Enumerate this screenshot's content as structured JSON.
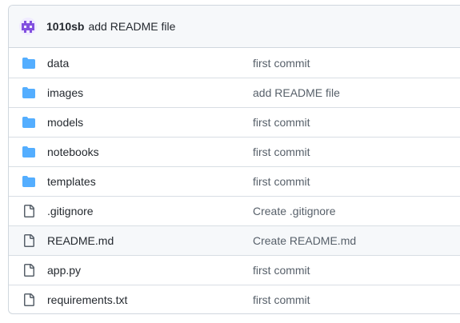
{
  "header": {
    "avatar_icon": "pixel-avatar-icon",
    "author": "1010sb",
    "message": "add README file"
  },
  "colors": {
    "folder": "#54aeff",
    "file_outline": "#57606a",
    "avatar": "#8250df"
  },
  "files": [
    {
      "name": "data",
      "type": "folder",
      "icon": "folder-icon",
      "commit": "first commit"
    },
    {
      "name": "images",
      "type": "folder",
      "icon": "folder-icon",
      "commit": "add README file"
    },
    {
      "name": "models",
      "type": "folder",
      "icon": "folder-icon",
      "commit": "first commit"
    },
    {
      "name": "notebooks",
      "type": "folder",
      "icon": "folder-icon",
      "commit": "first commit"
    },
    {
      "name": "templates",
      "type": "folder",
      "icon": "folder-icon",
      "commit": "first commit"
    },
    {
      "name": ".gitignore",
      "type": "file",
      "icon": "file-icon",
      "commit": "Create .gitignore"
    },
    {
      "name": "README.md",
      "type": "file",
      "icon": "file-icon",
      "commit": "Create README.md"
    },
    {
      "name": "app.py",
      "type": "file",
      "icon": "file-icon",
      "commit": "first commit"
    },
    {
      "name": "requirements.txt",
      "type": "file",
      "icon": "file-icon",
      "commit": "first commit"
    }
  ]
}
